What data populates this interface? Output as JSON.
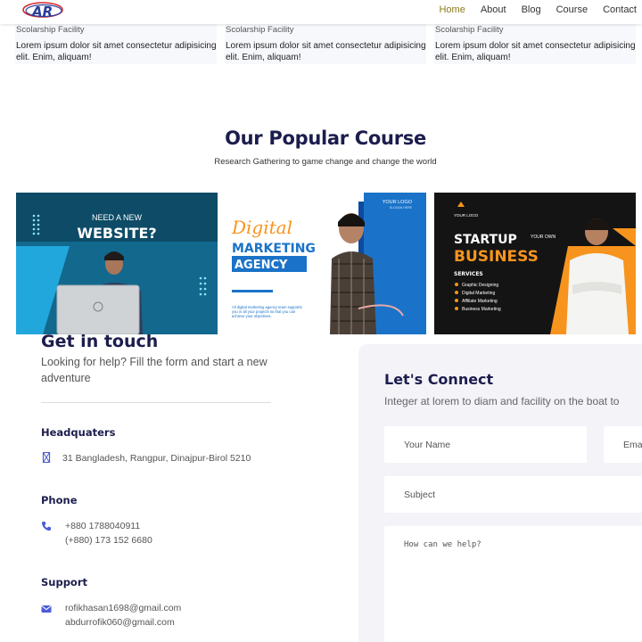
{
  "brand": {
    "logo_text": "AR"
  },
  "nav": {
    "items": [
      {
        "label": "Home",
        "active": true
      },
      {
        "label": "About",
        "active": false
      },
      {
        "label": "Blog",
        "active": false
      },
      {
        "label": "Course",
        "active": false
      },
      {
        "label": "Contact",
        "active": false
      }
    ]
  },
  "facilities": [
    {
      "title": "Scolarship Facility",
      "desc": "Lorem ipsum dolor sit amet consectetur adipisicing elit. Enim, aliquam!"
    },
    {
      "title": "Scolarship Facility",
      "desc": "Lorem ipsum dolor sit amet consectetur adipisicing elit. Enim, aliquam!"
    },
    {
      "title": "Scolarship Facility",
      "desc": "Lorem ipsum dolor sit amet consectetur adipisicing elit. Enim, aliquam!"
    }
  ],
  "courses": {
    "title": "Our Popular Course",
    "subtitle": "Research Gathering to game change and change the world",
    "items": [
      {
        "line1": "NEED A NEW",
        "line2": "WEBSITE?"
      },
      {
        "script": "Digital",
        "line1": "MARKETING",
        "line2": "AGENCY",
        "logo": "YOUR LOGO",
        "tag": "SLOGAN HERE",
        "body": "All digital marketing agency team supports you in all your projects so that you can achieve your objectives."
      },
      {
        "logo": "YOUR LOGO",
        "line1": "STARTUP",
        "small": "YOUR OWN",
        "line2": "BUSINESS",
        "services_title": "SERVICES",
        "services": [
          "Graphic Designing",
          "Digital Marketing",
          "Affiliate Marketing",
          "Business Marketing"
        ]
      }
    ]
  },
  "contact": {
    "title": "Get in touch",
    "subtitle": "Looking for help? Fill the form and start a new adventure",
    "headquarters_label": "Headquaters",
    "headquarters_value": "31 Bangladesh, Rangpur, Dinajpur-Birol 5210",
    "phone_label": "Phone",
    "phones": [
      "+880 1788040911",
      "(+880) 173 152 6680"
    ],
    "support_label": "Support",
    "emails": [
      "rofikhasan1698@gmail.com",
      "abdurrofik060@gmail.com"
    ]
  },
  "form": {
    "title": "Let's Connect",
    "subtitle": "Integer at lorem to diam and facility on the boat to",
    "name_placeholder": "Your Name",
    "email_placeholder": "Email",
    "subject_placeholder": "Subject",
    "message_placeholder": "How can we help?"
  },
  "colors": {
    "navy": "#1c1d4d",
    "accent": "#4b5cd6",
    "active_nav": "#8a7a1b",
    "orange": "#f7941d",
    "blue": "#1a73c8"
  }
}
